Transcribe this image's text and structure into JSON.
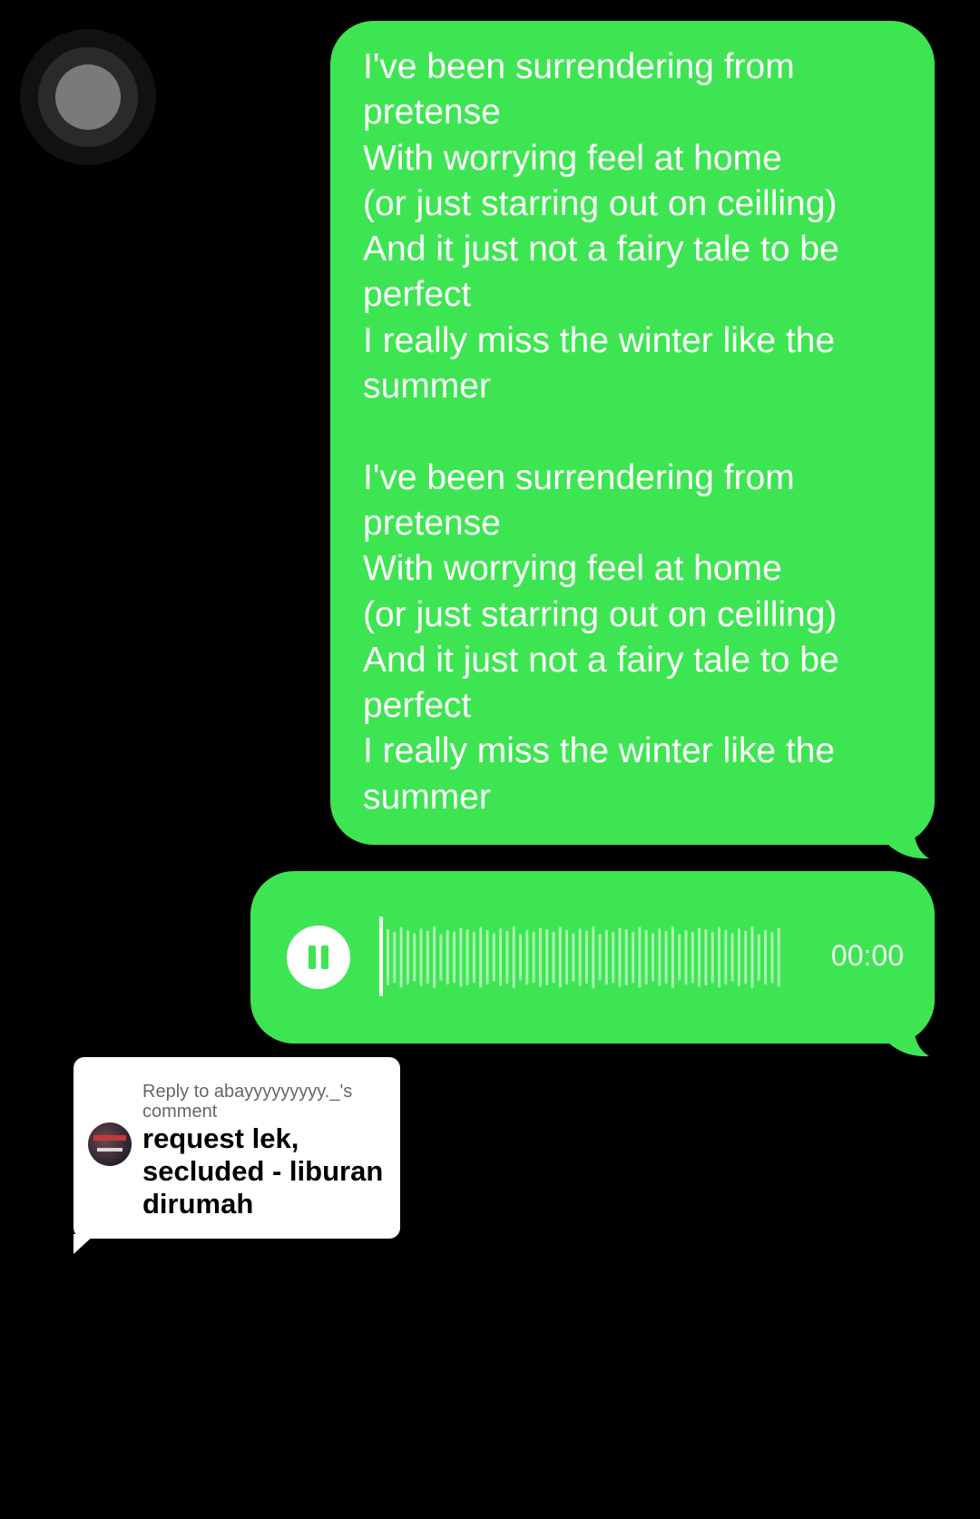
{
  "theme": {
    "background": "#000000",
    "bubble_color": "#3ee552",
    "bubble_text_color": "#ffffff"
  },
  "message": {
    "lyrics": "I've been surrendering from\npretense\nWith worrying feel at home\n(or just starring out on ceilling)\nAnd it just not a fairy tale to be\nperfect\nI really miss the winter like the\nsummer\n\nI've been surrendering from\npretense\nWith worrying feel at home\n(or just starring out on ceilling)\nAnd it just not a fairy tale to be\nperfect\nI really miss the winter like the\nsummer"
  },
  "voice_message": {
    "state": "playing",
    "control_icon": "pause-icon",
    "duration": "00:00",
    "progress": 0
  },
  "reply_card": {
    "label": "Reply to abayyyyyyyyy._'s comment",
    "comment": "request lek, secluded - liburan dirumah"
  }
}
